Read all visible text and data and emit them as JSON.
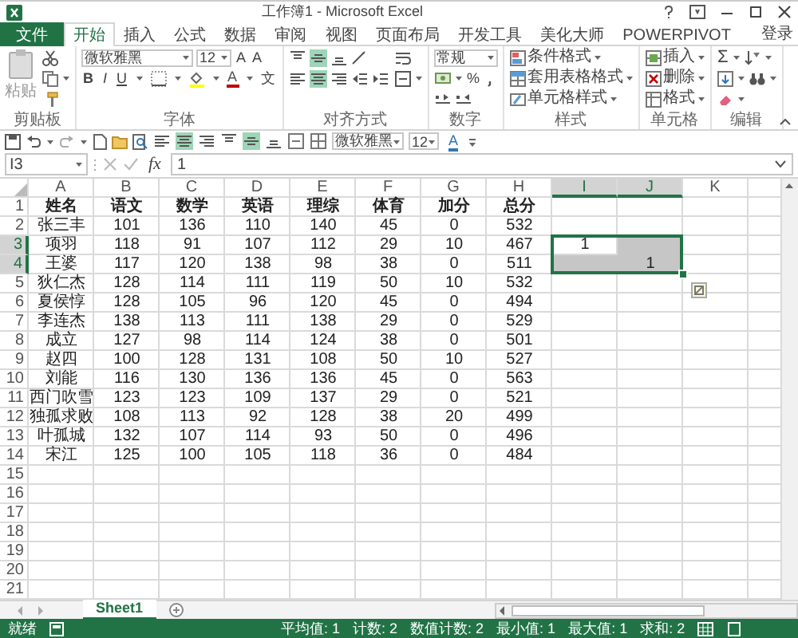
{
  "window": {
    "title": "工作簿1 - Microsoft Excel"
  },
  "ribbon_tabs": [
    {
      "label": "文件",
      "kind": "file",
      "selected": false
    },
    {
      "label": "开始",
      "kind": "tab",
      "selected": true
    },
    {
      "label": "插入",
      "kind": "tab",
      "selected": false
    },
    {
      "label": "公式",
      "kind": "tab",
      "selected": false
    },
    {
      "label": "数据",
      "kind": "tab",
      "selected": false
    },
    {
      "label": "审阅",
      "kind": "tab",
      "selected": false
    },
    {
      "label": "视图",
      "kind": "tab",
      "selected": false
    },
    {
      "label": "页面布局",
      "kind": "tab",
      "selected": false
    },
    {
      "label": "开发工具",
      "kind": "tab",
      "selected": false
    },
    {
      "label": "美化大师",
      "kind": "tab",
      "selected": false
    },
    {
      "label": "POWERPIVOT",
      "kind": "tab",
      "selected": false
    }
  ],
  "account": "登录",
  "ribbon": {
    "clipboard": {
      "paste_label": "粘贴",
      "group_label": "剪贴板"
    },
    "font": {
      "font_name": "微软雅黑",
      "font_size": "12",
      "grow_label": "A",
      "shrink_label": "A",
      "style_buttons": [
        "B",
        "I",
        "U"
      ],
      "font_color_label": "A",
      "phonetic_label": "文",
      "group_label": "字体"
    },
    "alignment": {
      "buttons": [
        {
          "kind": "top",
          "selected": false
        },
        {
          "kind": "middle",
          "selected": true
        },
        {
          "kind": "bottom",
          "selected": false
        },
        {
          "kind": "left",
          "selected": false
        },
        {
          "kind": "center",
          "selected": true
        },
        {
          "kind": "right",
          "selected": false
        }
      ],
      "group_label": "对齐方式"
    },
    "number": {
      "format": "常规",
      "percent_label": "%",
      "group_label": "数字"
    },
    "styles": {
      "commands": [
        "条件格式",
        "套用表格格式",
        "单元格样式"
      ],
      "group_label": "样式"
    },
    "cells": {
      "commands": [
        "插入",
        "删除",
        "格式"
      ],
      "group_label": "单元格"
    },
    "editing": {
      "sum_label": "Σ",
      "group_label": "编辑"
    }
  },
  "quick_access": {
    "align_buttons": [
      {
        "kind": "left",
        "selected": false
      },
      {
        "kind": "center",
        "selected": true
      },
      {
        "kind": "right",
        "selected": false
      },
      {
        "kind": "top",
        "selected": false
      },
      {
        "kind": "middle",
        "selected": true
      },
      {
        "kind": "bottom",
        "selected": false
      }
    ],
    "font_name": "微软雅黑",
    "font_size": "12",
    "font_color_label": "A"
  },
  "formula_bar": {
    "name_box": "I3",
    "fx_label": "fx",
    "formula": "1"
  },
  "sheet": {
    "columns": [
      {
        "label": "A",
        "selected": false
      },
      {
        "label": "B",
        "selected": false
      },
      {
        "label": "C",
        "selected": false
      },
      {
        "label": "D",
        "selected": false
      },
      {
        "label": "E",
        "selected": false
      },
      {
        "label": "F",
        "selected": false
      },
      {
        "label": "G",
        "selected": false
      },
      {
        "label": "H",
        "selected": false
      },
      {
        "label": "I",
        "selected": true
      },
      {
        "label": "J",
        "selected": true
      },
      {
        "label": "K",
        "selected": false
      }
    ],
    "rows": [
      {
        "number": "1",
        "selected": false,
        "bold": true,
        "cells": [
          "姓名",
          "语文",
          "数学",
          "英语",
          "理综",
          "体育",
          "加分",
          "总分"
        ]
      },
      {
        "number": "2",
        "selected": false,
        "bold": false,
        "cells": [
          "张三丰",
          "101",
          "136",
          "110",
          "140",
          "45",
          "0",
          "532"
        ]
      },
      {
        "number": "3",
        "selected": true,
        "bold": false,
        "cells": [
          "项羽",
          "118",
          "91",
          "107",
          "112",
          "29",
          "10",
          "467",
          "1"
        ]
      },
      {
        "number": "4",
        "selected": true,
        "bold": false,
        "cells": [
          "王婆",
          "117",
          "120",
          "138",
          "98",
          "38",
          "0",
          "511",
          null,
          "1"
        ]
      },
      {
        "number": "5",
        "selected": false,
        "bold": false,
        "cells": [
          "狄仁杰",
          "128",
          "114",
          "111",
          "119",
          "50",
          "10",
          "532"
        ]
      },
      {
        "number": "6",
        "selected": false,
        "bold": false,
        "cells": [
          "夏侯惇",
          "128",
          "105",
          "96",
          "120",
          "45",
          "0",
          "494"
        ]
      },
      {
        "number": "7",
        "selected": false,
        "bold": false,
        "cells": [
          "李连杰",
          "138",
          "113",
          "111",
          "138",
          "29",
          "0",
          "529"
        ]
      },
      {
        "number": "8",
        "selected": false,
        "bold": false,
        "cells": [
          "成立",
          "127",
          "98",
          "114",
          "124",
          "38",
          "0",
          "501"
        ]
      },
      {
        "number": "9",
        "selected": false,
        "bold": false,
        "cells": [
          "赵四",
          "100",
          "128",
          "131",
          "108",
          "50",
          "10",
          "527"
        ]
      },
      {
        "number": "10",
        "selected": false,
        "bold": false,
        "cells": [
          "刘能",
          "116",
          "130",
          "136",
          "136",
          "45",
          "0",
          "563"
        ]
      },
      {
        "number": "11",
        "selected": false,
        "bold": false,
        "cells": [
          "西门吹雪",
          "123",
          "123",
          "109",
          "137",
          "29",
          "0",
          "521"
        ]
      },
      {
        "number": "12",
        "selected": false,
        "bold": false,
        "cells": [
          "独孤求败",
          "108",
          "113",
          "92",
          "128",
          "38",
          "20",
          "499"
        ]
      },
      {
        "number": "13",
        "selected": false,
        "bold": false,
        "cells": [
          "叶孤城",
          "132",
          "107",
          "114",
          "93",
          "50",
          "0",
          "496"
        ]
      },
      {
        "number": "14",
        "selected": false,
        "bold": false,
        "cells": [
          "宋江",
          "125",
          "100",
          "105",
          "118",
          "36",
          "0",
          "484"
        ]
      },
      {
        "number": "15",
        "selected": false
      },
      {
        "number": "16",
        "selected": false
      },
      {
        "number": "17",
        "selected": false
      },
      {
        "number": "18",
        "selected": false
      },
      {
        "number": "19",
        "selected": false
      },
      {
        "number": "20",
        "selected": false
      },
      {
        "number": "21",
        "selected": false
      }
    ]
  },
  "sheet_tabs": [
    {
      "label": "Sheet1",
      "selected": true
    }
  ],
  "status_bar": {
    "ready": "就绪",
    "stats": [
      "平均值: 1",
      "计数: 2",
      "数值计数: 2",
      "最小值: 1",
      "最大值: 1",
      "求和: 2"
    ]
  }
}
